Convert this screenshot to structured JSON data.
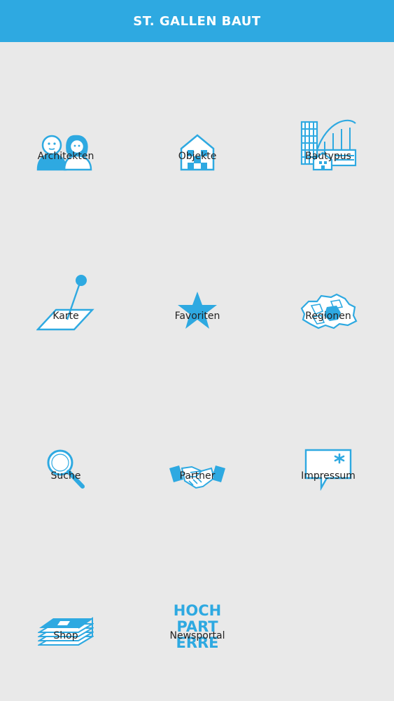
{
  "header": {
    "title": "ST. GALLEN BAUT"
  },
  "menu": [
    {
      "label": "Architekten",
      "icon": "architects-icon"
    },
    {
      "label": "Objekte",
      "icon": "house-icon"
    },
    {
      "label": "Bautypus",
      "icon": "building-types-icon"
    },
    {
      "label": "Karte",
      "icon": "map-pin-icon"
    },
    {
      "label": "Favoriten",
      "icon": "star-icon"
    },
    {
      "label": "Regionen",
      "icon": "regions-map-icon"
    },
    {
      "label": "Suche",
      "icon": "magnifier-icon"
    },
    {
      "label": "Partner",
      "icon": "handshake-icon"
    },
    {
      "label": "Impressum",
      "icon": "speech-bubble-icon"
    },
    {
      "label": "Shop",
      "icon": "stack-of-books-icon"
    },
    {
      "label": "Newsportal",
      "icon": "hochparterre-logo-icon",
      "logo_text": [
        "HOCH",
        "PART",
        "ERRE"
      ]
    }
  ],
  "colors": {
    "accent": "#2ea9e1",
    "background": "#e9e9e9",
    "text": "#222222"
  }
}
